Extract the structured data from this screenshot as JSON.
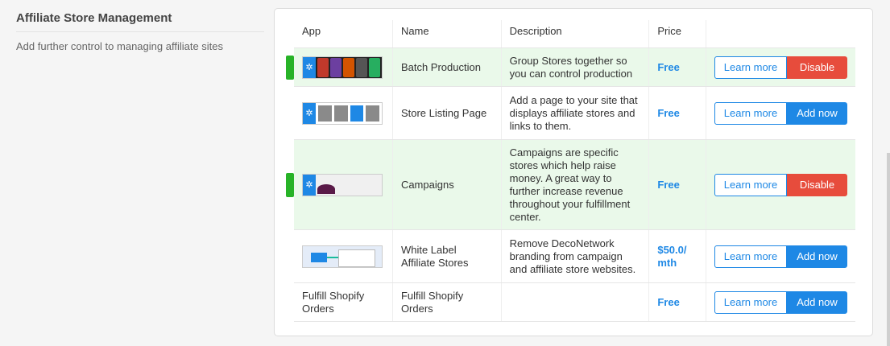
{
  "section": {
    "title": "Affiliate Store Management",
    "subtitle": "Add further control to managing affiliate sites"
  },
  "table": {
    "headers": [
      "App",
      "Name",
      "Description",
      "Price",
      ""
    ],
    "rows": [
      {
        "name": "Batch Production",
        "description": "Group Stores together so you can control production",
        "price": "Free",
        "learn": "Learn more",
        "action": "Disable",
        "active": true,
        "app_text": ""
      },
      {
        "name": "Store Listing Page",
        "description": "Add a page to your site that displays affiliate stores and links to them.",
        "price": "Free",
        "learn": "Learn more",
        "action": "Add now",
        "active": false,
        "app_text": ""
      },
      {
        "name": "Campaigns",
        "description": "Campaigns are specific stores which help raise money. A great way to further increase revenue throughout your fulfillment center.",
        "price": "Free",
        "learn": "Learn more",
        "action": "Disable",
        "active": true,
        "app_text": ""
      },
      {
        "name": "White Label Affiliate Stores",
        "description": "Remove DecoNetwork branding from campaign and affiliate store websites.",
        "price": "$50.0/ mth",
        "learn": "Learn more",
        "action": "Add now",
        "active": false,
        "app_text": ""
      },
      {
        "name": "Fulfill Shopify Orders",
        "description": "",
        "price": "Free",
        "learn": "Learn more",
        "action": "Add now",
        "active": false,
        "app_text": "Fulfill Shopify Orders"
      }
    ]
  },
  "colors": {
    "accent": "#1e88e5",
    "danger": "#e74c3c",
    "active_row": "#eaf9ea",
    "marker": "#27b327"
  }
}
